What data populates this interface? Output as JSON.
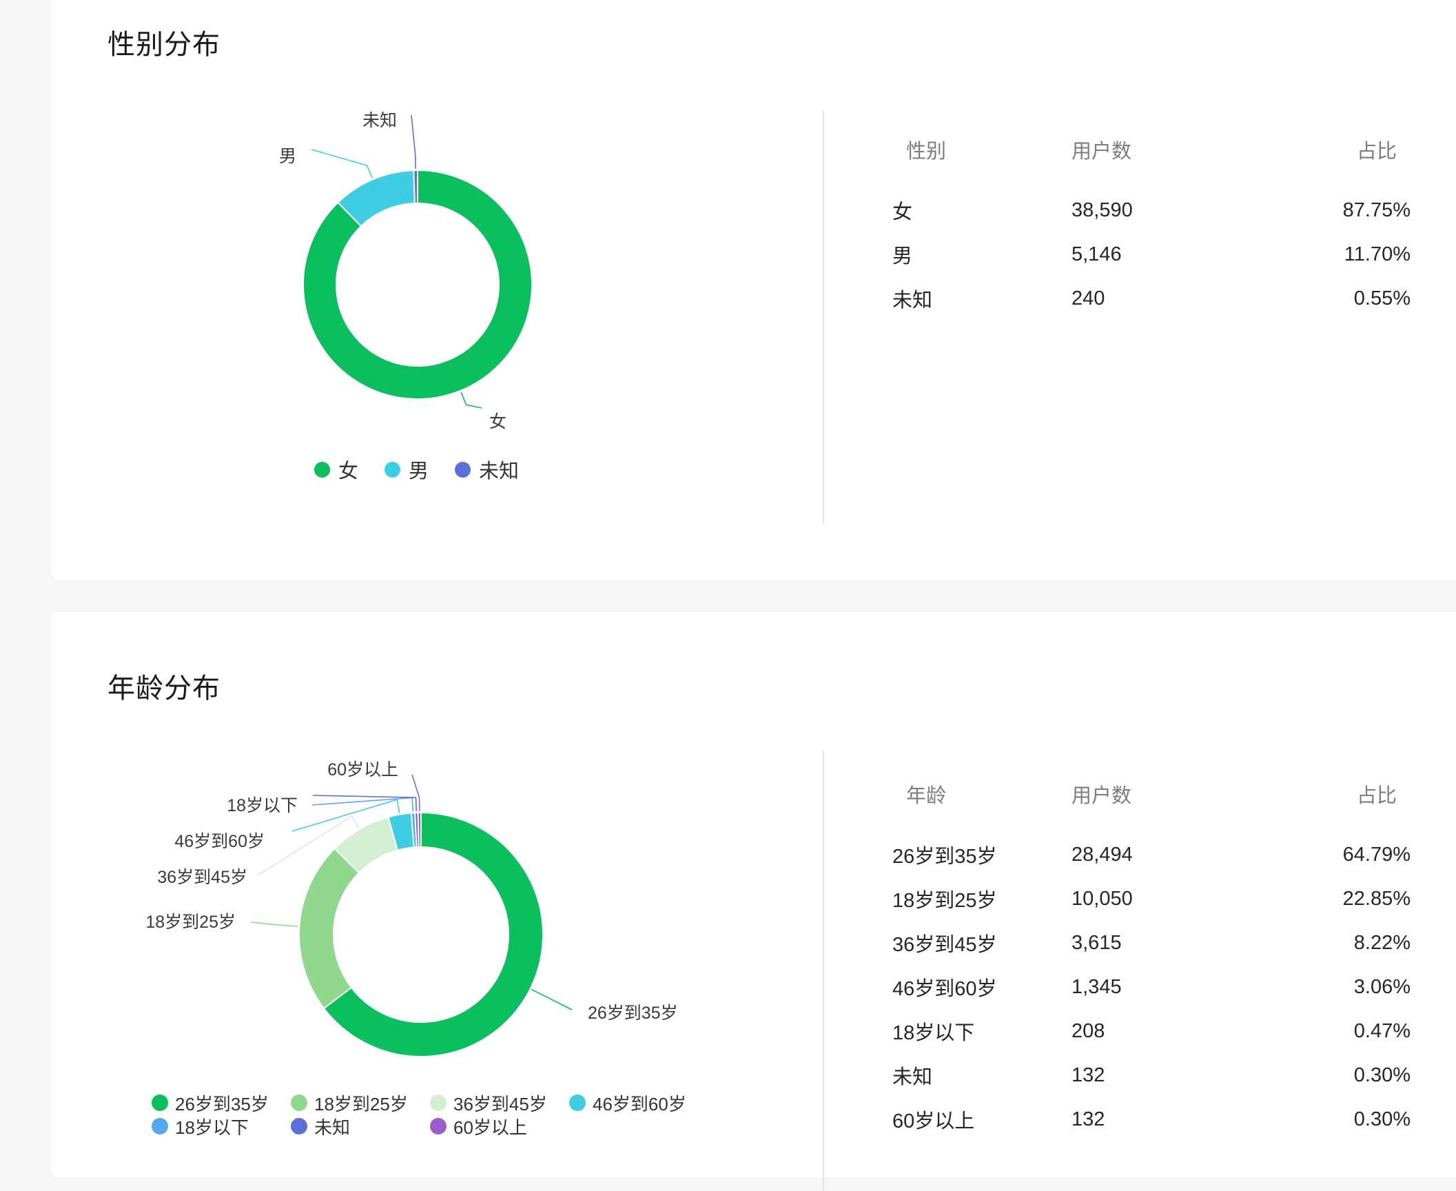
{
  "gender_section": {
    "title": "性别分布",
    "table": {
      "headers": [
        "性别",
        "用户数",
        "占比"
      ],
      "rows": [
        {
          "label": "女",
          "count": "38,590",
          "pct": "87.75%"
        },
        {
          "label": "男",
          "count": "5,146",
          "pct": "11.70%"
        },
        {
          "label": "未知",
          "count": "240",
          "pct": "0.55%"
        }
      ]
    },
    "legend": [
      {
        "label": "女",
        "color": "#0bbf5e"
      },
      {
        "label": "男",
        "color": "#3fcde3"
      },
      {
        "label": "未知",
        "color": "#5c6fd6"
      }
    ]
  },
  "age_section": {
    "title": "年龄分布",
    "table": {
      "headers": [
        "年龄",
        "用户数",
        "占比"
      ],
      "rows": [
        {
          "label": "26岁到35岁",
          "count": "28,494",
          "pct": "64.79%"
        },
        {
          "label": "18岁到25岁",
          "count": "10,050",
          "pct": "22.85%"
        },
        {
          "label": "36岁到45岁",
          "count": "3,615",
          "pct": "8.22%"
        },
        {
          "label": "46岁到60岁",
          "count": "1,345",
          "pct": "3.06%"
        },
        {
          "label": "18岁以下",
          "count": "208",
          "pct": "0.47%"
        },
        {
          "label": "未知",
          "count": "132",
          "pct": "0.30%"
        },
        {
          "label": "60岁以上",
          "count": "132",
          "pct": "0.30%"
        }
      ]
    },
    "legend": [
      {
        "label": "26岁到35岁",
        "color": "#0bbf5e"
      },
      {
        "label": "18岁到25岁",
        "color": "#8fd88e"
      },
      {
        "label": "36岁到45岁",
        "color": "#d3efd2"
      },
      {
        "label": "46岁到60岁",
        "color": "#3fcde3"
      },
      {
        "label": "18岁以下",
        "color": "#55a8ec"
      },
      {
        "label": "未知",
        "color": "#5c6fd6"
      },
      {
        "label": "60岁以上",
        "color": "#9a5ccf"
      }
    ]
  },
  "chart_data": [
    {
      "type": "pie",
      "variant": "donut",
      "title": "性别分布",
      "categories": [
        "女",
        "男",
        "未知"
      ],
      "values": [
        38590,
        5146,
        240
      ],
      "colors": [
        "#0bbf5e",
        "#3fcde3",
        "#5c6fd6"
      ],
      "legend": "bottom"
    },
    {
      "type": "pie",
      "variant": "donut",
      "title": "年龄分布",
      "categories": [
        "26岁到35岁",
        "18岁到25岁",
        "36岁到45岁",
        "46岁到60岁",
        "18岁以下",
        "未知",
        "60岁以上"
      ],
      "values": [
        28494,
        10050,
        3615,
        1345,
        208,
        132,
        132
      ],
      "colors": [
        "#0bbf5e",
        "#8fd88e",
        "#d3efd2",
        "#3fcde3",
        "#55a8ec",
        "#5c6fd6",
        "#9a5ccf"
      ],
      "legend": "bottom"
    }
  ]
}
